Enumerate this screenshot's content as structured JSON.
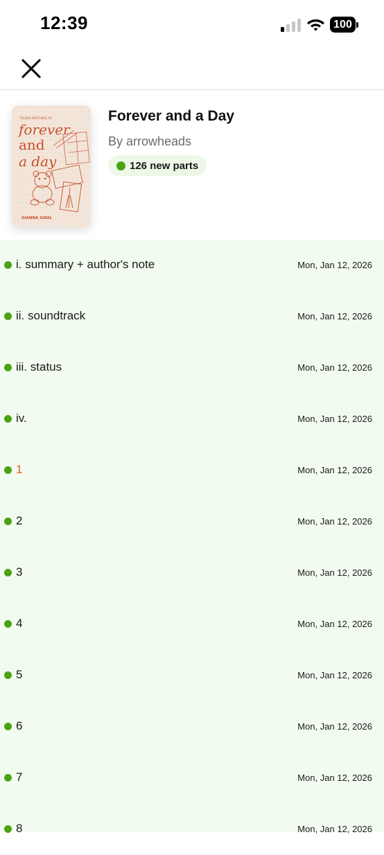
{
  "status_bar": {
    "time": "12:39",
    "battery": "100"
  },
  "nav": {
    "close_icon": "close-icon"
  },
  "story": {
    "title": "Forever and a Day",
    "author": "By arrowheads",
    "new_parts_label": "126 new parts",
    "cover": {
      "series_label": "TOLEDO BROTHERS #2",
      "title_line1": "forever",
      "title_line2": "and",
      "title_line3": "a day",
      "author_name": "GIANNA SIBAL"
    }
  },
  "parts": [
    {
      "title": "i. summary + author's note",
      "date": "Mon, Jan 12, 2026"
    },
    {
      "title": "ii. soundtrack",
      "date": "Mon, Jan 12, 2026"
    },
    {
      "title": "iii. status",
      "date": "Mon, Jan 12, 2026"
    },
    {
      "title": "iv.",
      "date": "Mon, Jan 12, 2026"
    },
    {
      "title": "1",
      "date": "Mon, Jan 12, 2026"
    },
    {
      "title": "2",
      "date": "Mon, Jan 12, 2026"
    },
    {
      "title": "3",
      "date": "Mon, Jan 12, 2026"
    },
    {
      "title": "4",
      "date": "Mon, Jan 12, 2026"
    },
    {
      "title": "5",
      "date": "Mon, Jan 12, 2026"
    },
    {
      "title": "6",
      "date": "Mon, Jan 12, 2026"
    },
    {
      "title": "7",
      "date": "Mon, Jan 12, 2026"
    },
    {
      "title": "8",
      "date": "Mon, Jan 12, 2026"
    }
  ],
  "colors": {
    "new_dot": "#4aa315",
    "current_part": "#e15a2a",
    "list_background": "#f2fbef",
    "badge_background": "#edf9e6"
  }
}
